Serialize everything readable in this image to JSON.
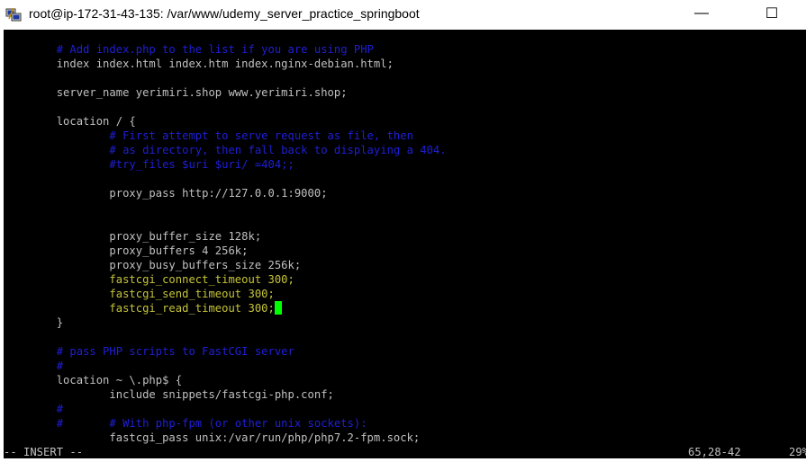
{
  "window": {
    "title": "root@ip-172-31-43-135: /var/www/udemy_server_practice_springboot",
    "icons": {
      "app": "putty-icon",
      "minimize": "minimize-icon",
      "maximize": "maximize-icon"
    },
    "minimize_glyph": "—",
    "maximize_glyph": "☐"
  },
  "colors": {
    "background": "#000000",
    "text": "#c0c0c0",
    "comment": "#1f1fd8",
    "directive_highlight": "#c6c43a",
    "cursor": "#00ff00"
  },
  "editor": {
    "lines": [
      {
        "text": "        # Add index.php to the list if you are using PHP",
        "style": "comment"
      },
      {
        "text": "        index index.html index.htm index.nginx-debian.html;",
        "style": "normal"
      },
      {
        "text": "",
        "style": "normal"
      },
      {
        "text": "        server_name yerimiri.shop www.yerimiri.shop;",
        "style": "normal"
      },
      {
        "text": "",
        "style": "normal"
      },
      {
        "text": "        location / {",
        "style": "normal"
      },
      {
        "text": "                # First attempt to serve request as file, then",
        "style": "comment"
      },
      {
        "text": "                # as directory, then fall back to displaying a 404.",
        "style": "comment"
      },
      {
        "text": "                #try_files $uri $uri/ =404;;",
        "style": "comment"
      },
      {
        "text": "",
        "style": "normal"
      },
      {
        "text": "                proxy_pass http://127.0.0.1:9000;",
        "style": "normal"
      },
      {
        "text": "",
        "style": "normal"
      },
      {
        "text": "",
        "style": "normal"
      },
      {
        "text": "                proxy_buffer_size 128k;",
        "style": "normal"
      },
      {
        "text": "                proxy_buffers 4 256k;",
        "style": "normal"
      },
      {
        "text": "                proxy_busy_buffers_size 256k;",
        "style": "normal"
      },
      {
        "text": "                fastcgi_connect_timeout 300;",
        "style": "yellow"
      },
      {
        "text": "                fastcgi_send_timeout 300;",
        "style": "yellow"
      },
      {
        "text": "                fastcgi_read_timeout 300;",
        "style": "yellow",
        "cursor": true
      },
      {
        "text": "        }",
        "style": "normal"
      },
      {
        "text": "",
        "style": "normal"
      },
      {
        "text": "        # pass PHP scripts to FastCGI server",
        "style": "comment"
      },
      {
        "text": "        #",
        "style": "comment"
      },
      {
        "text": "        location ~ \\.php$ {",
        "style": "normal"
      },
      {
        "text": "                include snippets/fastcgi-php.conf;",
        "style": "normal"
      },
      {
        "text": "        #",
        "style": "comment"
      },
      {
        "text": "        #       # With php-fpm (or other unix sockets):",
        "style": "comment"
      },
      {
        "text": "                fastcgi_pass unix:/var/run/php/php7.2-fpm.sock;",
        "style": "normal"
      }
    ]
  },
  "statusbar": {
    "mode": "-- INSERT --",
    "position": "65,28-42",
    "percent": "29%"
  }
}
